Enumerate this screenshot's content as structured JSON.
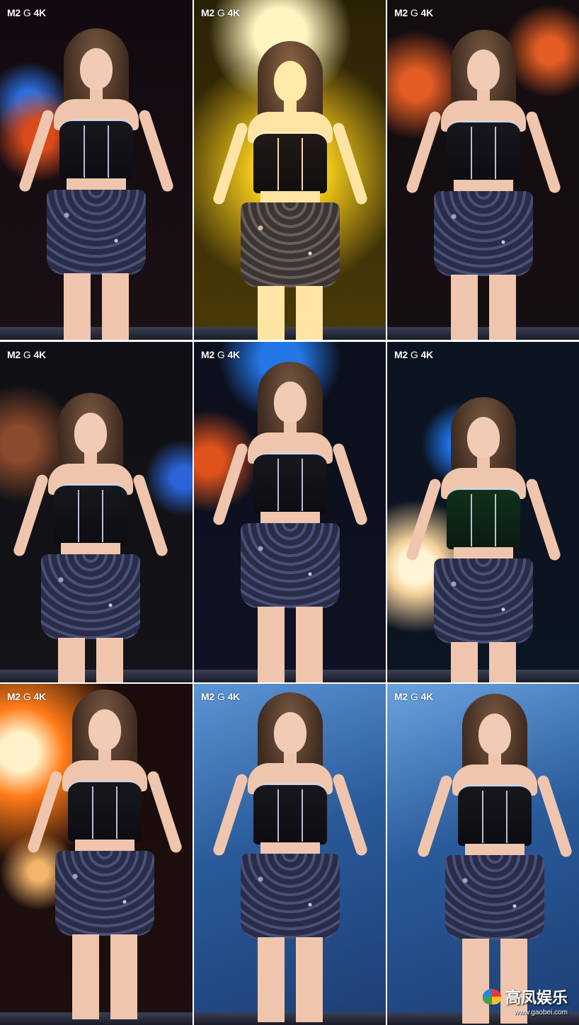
{
  "panels": [
    {
      "id": "p1",
      "logo": {
        "m2": "M2",
        "g": "G",
        "k": "4K"
      },
      "scene": {
        "bg": "#1a1016",
        "accent1": "#d94b1c",
        "accent2": "#2b6fe0",
        "tint": "none"
      }
    },
    {
      "id": "p2",
      "logo": {
        "m2": "M2",
        "g": "G",
        "k": "4K"
      },
      "scene": {
        "bg": "#4a3a08",
        "accent1": "#f0c61a",
        "accent2": "#e4d48a",
        "tint": "yellow"
      }
    },
    {
      "id": "p3",
      "logo": {
        "m2": "M2",
        "g": "G",
        "k": "4K"
      },
      "scene": {
        "bg": "#160f12",
        "accent1": "#e45d24",
        "accent2": "#2c3d7a",
        "tint": "none"
      }
    },
    {
      "id": "p4",
      "logo": {
        "m2": "M2",
        "g": "G",
        "k": "4K"
      },
      "scene": {
        "bg": "#141418",
        "accent1": "#8a4a2c",
        "accent2": "#2a64d8",
        "tint": "none"
      }
    },
    {
      "id": "p5",
      "logo": {
        "m2": "M2",
        "g": "G",
        "k": "4K"
      },
      "scene": {
        "bg": "#0e1222",
        "accent1": "#e0521c",
        "accent2": "#2377e6",
        "tint": "none"
      }
    },
    {
      "id": "p6",
      "logo": {
        "m2": "M2",
        "g": "G",
        "k": "4K"
      },
      "scene": {
        "bg": "#0c1522",
        "accent1": "#f3d19a",
        "accent2": "#1f78f2",
        "tint": "green"
      }
    },
    {
      "id": "p7",
      "logo": {
        "m2": "M2",
        "g": "G",
        "k": "4K"
      },
      "scene": {
        "bg": "#1c0f0d",
        "accent1": "#ff7a18",
        "accent2": "#f2b36a",
        "tint": "warm"
      }
    },
    {
      "id": "p8",
      "logo": {
        "m2": "M2",
        "g": "G",
        "k": "4K"
      },
      "scene": {
        "bg": "#2a5a9a",
        "accent1": "#5c95d6",
        "accent2": "#1d3e74",
        "tint": "none"
      }
    },
    {
      "id": "p9",
      "logo": {
        "m2": "M2",
        "g": "G",
        "k": "4K"
      },
      "scene": {
        "bg": "#2a5a9a",
        "accent1": "#6aa3e0",
        "accent2": "#1d3e74",
        "tint": "none"
      }
    }
  ],
  "watermark": {
    "text": "高凤娱乐",
    "url": "www.gaobei.com"
  },
  "colors": {
    "gutter": "#ffffff",
    "logo_text": "#ffffff"
  }
}
